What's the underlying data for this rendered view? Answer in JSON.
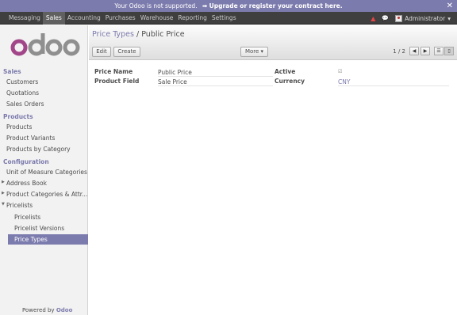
{
  "announce": {
    "text": "Your Odoo is not supported.",
    "link": "Upgrade or register your contract here."
  },
  "menu": [
    "Messaging",
    "Sales",
    "Accounting",
    "Purchases",
    "Warehouse",
    "Reporting",
    "Settings"
  ],
  "active_menu": "Sales",
  "user": "Administrator",
  "sidebar": {
    "sections": {
      "sales": "Sales",
      "products": "Products",
      "configuration": "Configuration"
    },
    "sales_items": [
      "Customers",
      "Quotations",
      "Sales Orders"
    ],
    "products_items": [
      "Products",
      "Product Variants",
      "Products by Category"
    ],
    "config_items": [
      "Unit of Measure Categories",
      "Address Book",
      "Product Categories & Attr...",
      "Pricelists"
    ],
    "pricelists_items": [
      "Pricelists",
      "Pricelist Versions",
      "Price Types"
    ],
    "powered_by": "Powered by",
    "powered_brand": "Odoo"
  },
  "breadcrumb": {
    "parent": "Price Types",
    "sep": "/",
    "current": "Public Price"
  },
  "buttons": {
    "edit": "Edit",
    "create": "Create",
    "more": "More"
  },
  "pager": {
    "text": "1 / 2"
  },
  "form": {
    "price_name_label": "Price Name",
    "price_name_value": "Public Price",
    "product_field_label": "Product Field",
    "product_field_value": "Sale Price",
    "active_label": "Active",
    "active_value": true,
    "currency_label": "Currency",
    "currency_value": "CNY"
  },
  "colors": {
    "accent": "#7c7bad",
    "topbar": "#3f3f3f",
    "sidebar": "#f2f2f2"
  }
}
